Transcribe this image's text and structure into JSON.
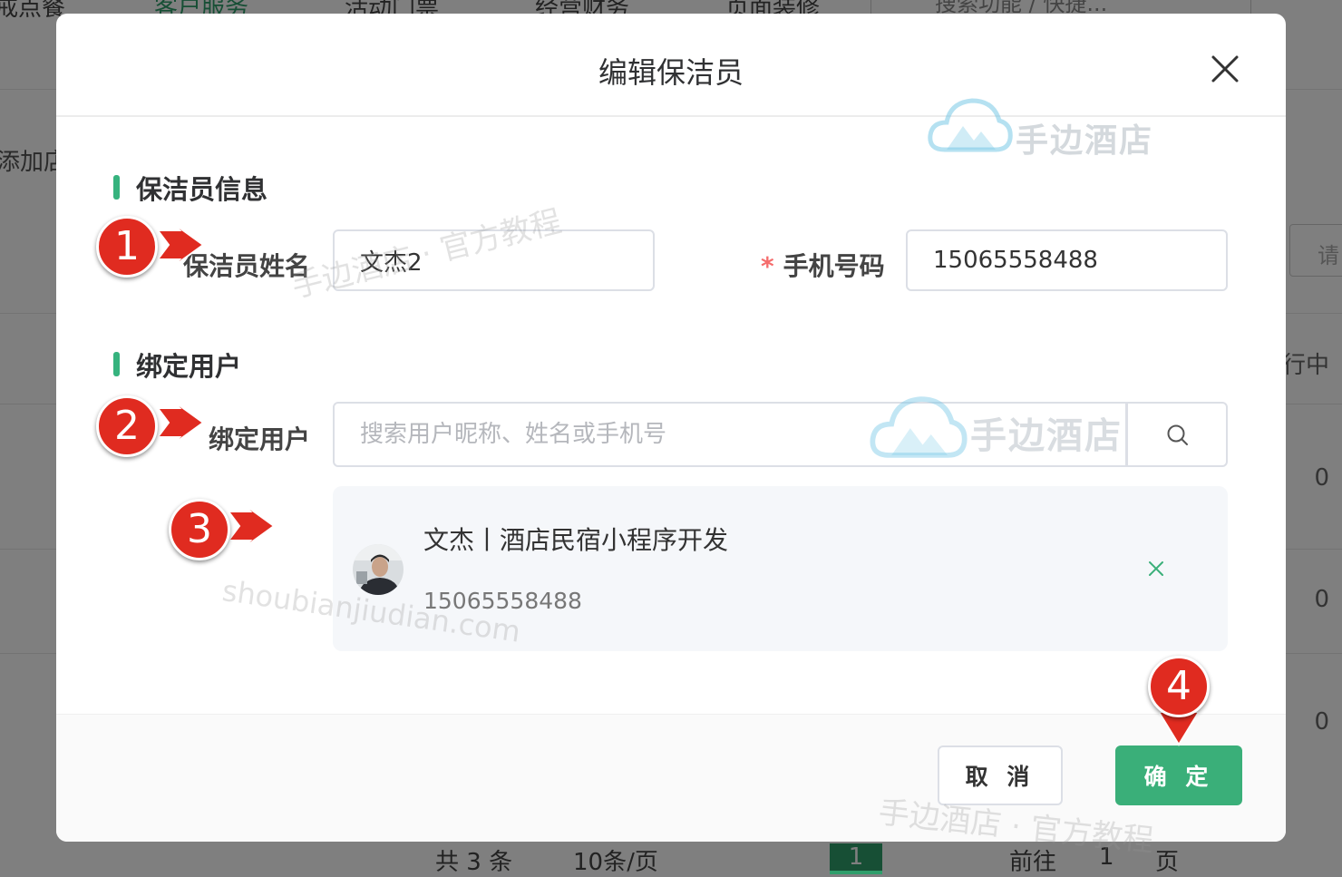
{
  "background": {
    "nav": [
      "戒点餐",
      "客户服务",
      "活动门票",
      "经营财务",
      "页面装修"
    ],
    "search_placeholder": "搜索功能 / 快捷...",
    "left_text": "添加店",
    "right_input_placeholder": "请",
    "status_text": "行中",
    "counts": [
      "0",
      "0",
      "0"
    ],
    "pager": {
      "total": "共 3 条",
      "page_size": "10条/页",
      "current": "1",
      "goto_label": "前往",
      "goto_value": "1",
      "page_suffix": "页"
    }
  },
  "modal": {
    "title": "编辑保洁员",
    "sections": {
      "info_title": "保洁员信息",
      "bind_title": "绑定用户"
    },
    "form": {
      "name_label": "保洁员姓名",
      "name_value": "文杰2",
      "phone_label": "手机号码",
      "phone_required_mark": "*",
      "phone_value": "15065558488",
      "bind_label": "绑定用户",
      "bind_placeholder": "搜索用户昵称、姓名或手机号"
    },
    "bound_user": {
      "name": "文杰丨酒店民宿小程序开发",
      "phone": "15065558488"
    },
    "footer": {
      "cancel_label": "取 消",
      "confirm_label": "确 定"
    }
  },
  "steps": [
    "1",
    "2",
    "3",
    "4"
  ],
  "watermarks": {
    "logo_text": "手边酒店",
    "tutorial": "手边酒店 · 官方教程",
    "domain": "shoubianjiudian.com"
  },
  "colors": {
    "accent": "#36b37e",
    "confirm": "#3aaf79",
    "marker": "#e02b20",
    "required": "#f56c6c"
  }
}
